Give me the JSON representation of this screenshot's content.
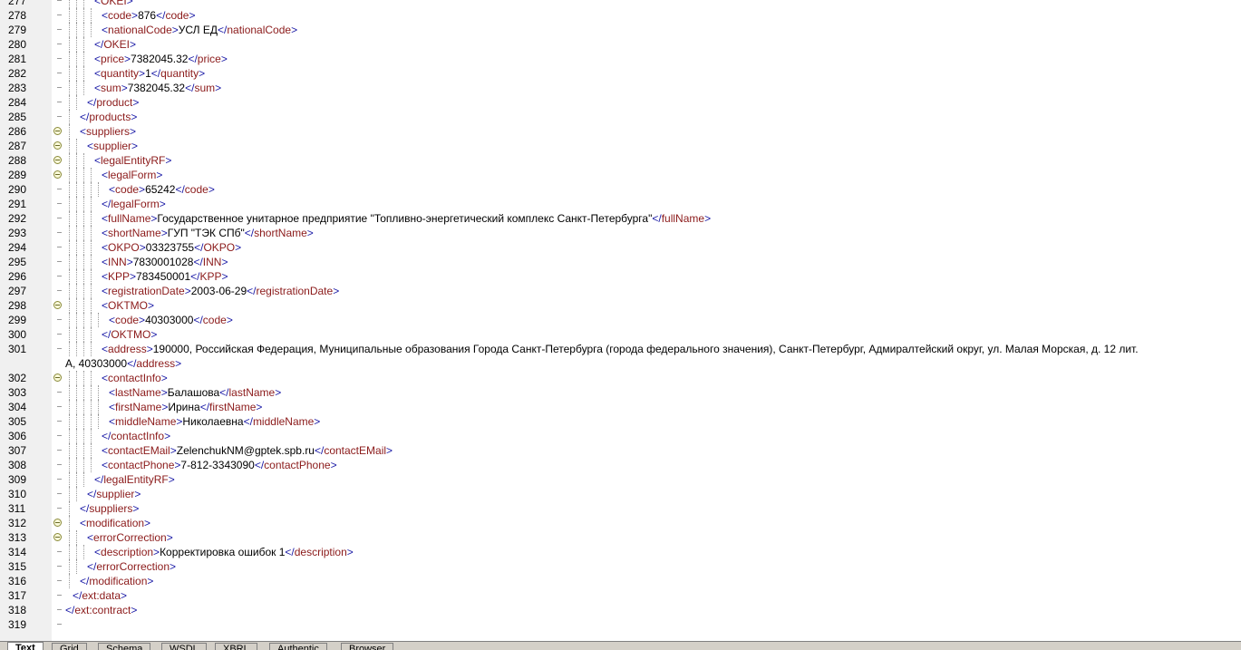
{
  "lines": [
    {
      "n": "277",
      "depth": 4,
      "fold": false,
      "segs": [
        [
          "b",
          "<"
        ],
        [
          "t",
          "OKEI"
        ],
        [
          "b",
          ">"
        ]
      ]
    },
    {
      "n": "278",
      "depth": 5,
      "fold": false,
      "segs": [
        [
          "b",
          "<"
        ],
        [
          "t",
          "code"
        ],
        [
          "b",
          ">"
        ],
        [
          "x",
          "876"
        ],
        [
          "b",
          "</"
        ],
        [
          "t",
          "code"
        ],
        [
          "b",
          ">"
        ]
      ]
    },
    {
      "n": "279",
      "depth": 5,
      "fold": false,
      "segs": [
        [
          "b",
          "<"
        ],
        [
          "t",
          "nationalCode"
        ],
        [
          "b",
          ">"
        ],
        [
          "x",
          "УСЛ ЕД"
        ],
        [
          "b",
          "</"
        ],
        [
          "t",
          "nationalCode"
        ],
        [
          "b",
          ">"
        ]
      ]
    },
    {
      "n": "280",
      "depth": 4,
      "fold": false,
      "segs": [
        [
          "b",
          "</"
        ],
        [
          "t",
          "OKEI"
        ],
        [
          "b",
          ">"
        ]
      ]
    },
    {
      "n": "281",
      "depth": 4,
      "fold": false,
      "segs": [
        [
          "b",
          "<"
        ],
        [
          "t",
          "price"
        ],
        [
          "b",
          ">"
        ],
        [
          "x",
          "7382045.32"
        ],
        [
          "b",
          "</"
        ],
        [
          "t",
          "price"
        ],
        [
          "b",
          ">"
        ]
      ]
    },
    {
      "n": "282",
      "depth": 4,
      "fold": false,
      "segs": [
        [
          "b",
          "<"
        ],
        [
          "t",
          "quantity"
        ],
        [
          "b",
          ">"
        ],
        [
          "x",
          "1"
        ],
        [
          "b",
          "</"
        ],
        [
          "t",
          "quantity"
        ],
        [
          "b",
          ">"
        ]
      ]
    },
    {
      "n": "283",
      "depth": 4,
      "fold": false,
      "segs": [
        [
          "b",
          "<"
        ],
        [
          "t",
          "sum"
        ],
        [
          "b",
          ">"
        ],
        [
          "x",
          "7382045.32"
        ],
        [
          "b",
          "</"
        ],
        [
          "t",
          "sum"
        ],
        [
          "b",
          ">"
        ]
      ]
    },
    {
      "n": "284",
      "depth": 3,
      "fold": false,
      "segs": [
        [
          "b",
          "</"
        ],
        [
          "t",
          "product"
        ],
        [
          "b",
          ">"
        ]
      ]
    },
    {
      "n": "285",
      "depth": 2,
      "fold": false,
      "segs": [
        [
          "b",
          "</"
        ],
        [
          "t",
          "products"
        ],
        [
          "b",
          ">"
        ]
      ]
    },
    {
      "n": "286",
      "depth": 2,
      "fold": true,
      "segs": [
        [
          "b",
          "<"
        ],
        [
          "t",
          "suppliers"
        ],
        [
          "b",
          ">"
        ]
      ]
    },
    {
      "n": "287",
      "depth": 3,
      "fold": true,
      "segs": [
        [
          "b",
          "<"
        ],
        [
          "t",
          "supplier"
        ],
        [
          "b",
          ">"
        ]
      ]
    },
    {
      "n": "288",
      "depth": 4,
      "fold": true,
      "segs": [
        [
          "b",
          "<"
        ],
        [
          "t",
          "legalEntityRF"
        ],
        [
          "b",
          ">"
        ]
      ]
    },
    {
      "n": "289",
      "depth": 5,
      "fold": true,
      "segs": [
        [
          "b",
          "<"
        ],
        [
          "t",
          "legalForm"
        ],
        [
          "b",
          ">"
        ]
      ]
    },
    {
      "n": "290",
      "depth": 6,
      "fold": false,
      "segs": [
        [
          "b",
          "<"
        ],
        [
          "t",
          "code"
        ],
        [
          "b",
          ">"
        ],
        [
          "x",
          "65242"
        ],
        [
          "b",
          "</"
        ],
        [
          "t",
          "code"
        ],
        [
          "b",
          ">"
        ]
      ]
    },
    {
      "n": "291",
      "depth": 5,
      "fold": false,
      "segs": [
        [
          "b",
          "</"
        ],
        [
          "t",
          "legalForm"
        ],
        [
          "b",
          ">"
        ]
      ]
    },
    {
      "n": "292",
      "depth": 5,
      "fold": false,
      "segs": [
        [
          "b",
          "<"
        ],
        [
          "t",
          "fullName"
        ],
        [
          "b",
          ">"
        ],
        [
          "x",
          "Государственное унитарное предприятие \"Топливно-энергетический комплекс Санкт-Петербурга\""
        ],
        [
          "b",
          "</"
        ],
        [
          "t",
          "fullName"
        ],
        [
          "b",
          ">"
        ]
      ]
    },
    {
      "n": "293",
      "depth": 5,
      "fold": false,
      "segs": [
        [
          "b",
          "<"
        ],
        [
          "t",
          "shortName"
        ],
        [
          "b",
          ">"
        ],
        [
          "x",
          "ГУП \"ТЭК СПб\""
        ],
        [
          "b",
          "</"
        ],
        [
          "t",
          "shortName"
        ],
        [
          "b",
          ">"
        ]
      ]
    },
    {
      "n": "294",
      "depth": 5,
      "fold": false,
      "segs": [
        [
          "b",
          "<"
        ],
        [
          "t",
          "OKPO"
        ],
        [
          "b",
          ">"
        ],
        [
          "x",
          "03323755"
        ],
        [
          "b",
          "</"
        ],
        [
          "t",
          "OKPO"
        ],
        [
          "b",
          ">"
        ]
      ]
    },
    {
      "n": "295",
      "depth": 5,
      "fold": false,
      "segs": [
        [
          "b",
          "<"
        ],
        [
          "t",
          "INN"
        ],
        [
          "b",
          ">"
        ],
        [
          "x",
          "7830001028"
        ],
        [
          "b",
          "</"
        ],
        [
          "t",
          "INN"
        ],
        [
          "b",
          ">"
        ]
      ]
    },
    {
      "n": "296",
      "depth": 5,
      "fold": false,
      "segs": [
        [
          "b",
          "<"
        ],
        [
          "t",
          "KPP"
        ],
        [
          "b",
          ">"
        ],
        [
          "x",
          "783450001"
        ],
        [
          "b",
          "</"
        ],
        [
          "t",
          "KPP"
        ],
        [
          "b",
          ">"
        ]
      ]
    },
    {
      "n": "297",
      "depth": 5,
      "fold": false,
      "segs": [
        [
          "b",
          "<"
        ],
        [
          "t",
          "registrationDate"
        ],
        [
          "b",
          ">"
        ],
        [
          "x",
          "2003-06-29"
        ],
        [
          "b",
          "</"
        ],
        [
          "t",
          "registrationDate"
        ],
        [
          "b",
          ">"
        ]
      ]
    },
    {
      "n": "298",
      "depth": 5,
      "fold": true,
      "segs": [
        [
          "b",
          "<"
        ],
        [
          "t",
          "OKTMO"
        ],
        [
          "b",
          ">"
        ]
      ]
    },
    {
      "n": "299",
      "depth": 6,
      "fold": false,
      "segs": [
        [
          "b",
          "<"
        ],
        [
          "t",
          "code"
        ],
        [
          "b",
          ">"
        ],
        [
          "x",
          "40303000"
        ],
        [
          "b",
          "</"
        ],
        [
          "t",
          "code"
        ],
        [
          "b",
          ">"
        ]
      ]
    },
    {
      "n": "300",
      "depth": 5,
      "fold": false,
      "segs": [
        [
          "b",
          "</"
        ],
        [
          "t",
          "OKTMO"
        ],
        [
          "b",
          ">"
        ]
      ]
    },
    {
      "n": "301",
      "depth": 5,
      "fold": false,
      "segs": [
        [
          "b",
          "<"
        ],
        [
          "t",
          "address"
        ],
        [
          "b",
          ">"
        ],
        [
          "x",
          "190000, Российская Федерация, Муниципальные образования Города Санкт-Петербурга (города федерального значения), Санкт-Петербург, Адмиралтейский округ, ул. Малая Морская, д. 12 лит."
        ]
      ]
    },
    {
      "n": "",
      "depth": 0,
      "fold": false,
      "wrap": true,
      "segs": [
        [
          "x",
          "А, 40303000"
        ],
        [
          "b",
          "</"
        ],
        [
          "t",
          "address"
        ],
        [
          "b",
          ">"
        ]
      ]
    },
    {
      "n": "302",
      "depth": 5,
      "fold": true,
      "segs": [
        [
          "b",
          "<"
        ],
        [
          "t",
          "contactInfo"
        ],
        [
          "b",
          ">"
        ]
      ]
    },
    {
      "n": "303",
      "depth": 6,
      "fold": false,
      "segs": [
        [
          "b",
          "<"
        ],
        [
          "t",
          "lastName"
        ],
        [
          "b",
          ">"
        ],
        [
          "x",
          "Балашова"
        ],
        [
          "b",
          "</"
        ],
        [
          "t",
          "lastName"
        ],
        [
          "b",
          ">"
        ]
      ]
    },
    {
      "n": "304",
      "depth": 6,
      "fold": false,
      "segs": [
        [
          "b",
          "<"
        ],
        [
          "t",
          "firstName"
        ],
        [
          "b",
          ">"
        ],
        [
          "x",
          "Ирина"
        ],
        [
          "b",
          "</"
        ],
        [
          "t",
          "firstName"
        ],
        [
          "b",
          ">"
        ]
      ]
    },
    {
      "n": "305",
      "depth": 6,
      "fold": false,
      "segs": [
        [
          "b",
          "<"
        ],
        [
          "t",
          "middleName"
        ],
        [
          "b",
          ">"
        ],
        [
          "x",
          "Николаевна"
        ],
        [
          "b",
          "</"
        ],
        [
          "t",
          "middleName"
        ],
        [
          "b",
          ">"
        ]
      ]
    },
    {
      "n": "306",
      "depth": 5,
      "fold": false,
      "segs": [
        [
          "b",
          "</"
        ],
        [
          "t",
          "contactInfo"
        ],
        [
          "b",
          ">"
        ]
      ]
    },
    {
      "n": "307",
      "depth": 5,
      "fold": false,
      "segs": [
        [
          "b",
          "<"
        ],
        [
          "t",
          "contactEMail"
        ],
        [
          "b",
          ">"
        ],
        [
          "x",
          "ZelenchukNM@gptek.spb.ru"
        ],
        [
          "b",
          "</"
        ],
        [
          "t",
          "contactEMail"
        ],
        [
          "b",
          ">"
        ]
      ]
    },
    {
      "n": "308",
      "depth": 5,
      "fold": false,
      "segs": [
        [
          "b",
          "<"
        ],
        [
          "t",
          "contactPhone"
        ],
        [
          "b",
          ">"
        ],
        [
          "x",
          "7-812-3343090"
        ],
        [
          "b",
          "</"
        ],
        [
          "t",
          "contactPhone"
        ],
        [
          "b",
          ">"
        ]
      ]
    },
    {
      "n": "309",
      "depth": 4,
      "fold": false,
      "segs": [
        [
          "b",
          "</"
        ],
        [
          "t",
          "legalEntityRF"
        ],
        [
          "b",
          ">"
        ]
      ]
    },
    {
      "n": "310",
      "depth": 3,
      "fold": false,
      "segs": [
        [
          "b",
          "</"
        ],
        [
          "t",
          "supplier"
        ],
        [
          "b",
          ">"
        ]
      ]
    },
    {
      "n": "311",
      "depth": 2,
      "fold": false,
      "segs": [
        [
          "b",
          "</"
        ],
        [
          "t",
          "suppliers"
        ],
        [
          "b",
          ">"
        ]
      ]
    },
    {
      "n": "312",
      "depth": 2,
      "fold": true,
      "segs": [
        [
          "b",
          "<"
        ],
        [
          "t",
          "modification"
        ],
        [
          "b",
          ">"
        ]
      ]
    },
    {
      "n": "313",
      "depth": 3,
      "fold": true,
      "segs": [
        [
          "b",
          "<"
        ],
        [
          "t",
          "errorCorrection"
        ],
        [
          "b",
          ">"
        ]
      ]
    },
    {
      "n": "314",
      "depth": 4,
      "fold": false,
      "segs": [
        [
          "b",
          "<"
        ],
        [
          "t",
          "description"
        ],
        [
          "b",
          ">"
        ],
        [
          "x",
          "Корректировка ошибок 1"
        ],
        [
          "b",
          "</"
        ],
        [
          "t",
          "description"
        ],
        [
          "b",
          ">"
        ]
      ]
    },
    {
      "n": "315",
      "depth": 3,
      "fold": false,
      "segs": [
        [
          "b",
          "</"
        ],
        [
          "t",
          "errorCorrection"
        ],
        [
          "b",
          ">"
        ]
      ]
    },
    {
      "n": "316",
      "depth": 2,
      "fold": false,
      "segs": [
        [
          "b",
          "</"
        ],
        [
          "t",
          "modification"
        ],
        [
          "b",
          ">"
        ]
      ]
    },
    {
      "n": "317",
      "depth": 1,
      "fold": false,
      "segs": [
        [
          "b",
          "</"
        ],
        [
          "t",
          "ext:data"
        ],
        [
          "b",
          ">"
        ]
      ]
    },
    {
      "n": "318",
      "depth": 0,
      "fold": false,
      "segs": [
        [
          "b",
          "</"
        ],
        [
          "t",
          "ext:contract"
        ],
        [
          "b",
          ">"
        ]
      ]
    },
    {
      "n": "319",
      "depth": 0,
      "fold": false,
      "segs": []
    }
  ],
  "tabs": [
    "Text",
    "Grid",
    "Schema",
    "WSDL",
    "XBRL",
    "Authentic",
    "Browser"
  ],
  "active_tab": 0,
  "colors": {
    "tag": "#8b1a1a",
    "bracket": "#1a1aa6",
    "text": "#000000"
  }
}
